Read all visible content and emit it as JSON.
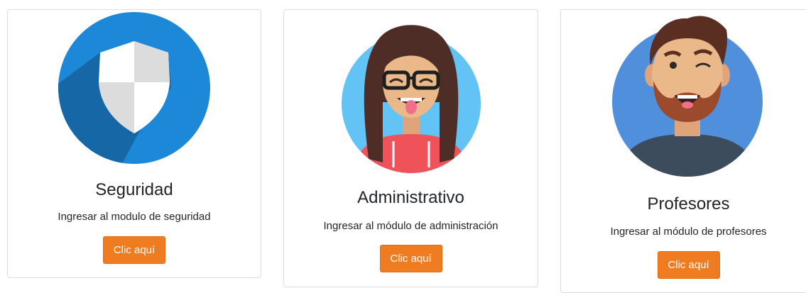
{
  "cards": [
    {
      "title": "Seguridad",
      "text": "Ingresar al modulo de seguridad",
      "button_label": "Clic aquí",
      "icon": "shield-icon"
    },
    {
      "title": "Administrativo",
      "text": "Ingresar al módulo de administración",
      "button_label": "Clic aquí",
      "icon": "woman-avatar-icon"
    },
    {
      "title": "Profesores",
      "text": "Ingresar al módulo de profesores",
      "button_label": "Clic aquí",
      "icon": "man-avatar-icon"
    }
  ],
  "colors": {
    "button": "#f07c22",
    "shield_bg": "#1e88d8",
    "woman_bg": "#62c3f4",
    "man_bg": "#4f8fdb"
  }
}
